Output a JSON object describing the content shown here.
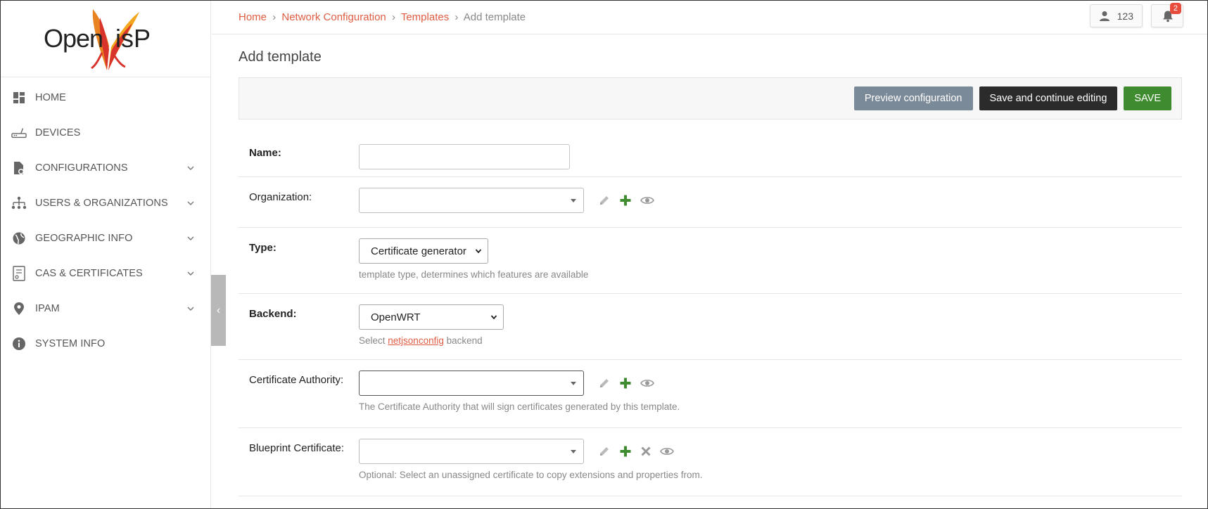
{
  "brand": {
    "logo_text": "OpenWISP"
  },
  "sidebar": {
    "items": [
      {
        "label": "HOME",
        "icon": "dashboard-icon",
        "expandable": false
      },
      {
        "label": "DEVICES",
        "icon": "router-icon",
        "expandable": false
      },
      {
        "label": "CONFIGURATIONS",
        "icon": "config-file-icon",
        "expandable": true
      },
      {
        "label": "USERS & ORGANIZATIONS",
        "icon": "org-chart-icon",
        "expandable": true
      },
      {
        "label": "GEOGRAPHIC INFO",
        "icon": "globe-icon",
        "expandable": true
      },
      {
        "label": "CAS & CERTIFICATES",
        "icon": "certificate-icon",
        "expandable": true
      },
      {
        "label": "IPAM",
        "icon": "location-pin-icon",
        "expandable": true
      },
      {
        "label": "SYSTEM INFO",
        "icon": "info-icon",
        "expandable": false
      }
    ],
    "collapse_glyph": "‹"
  },
  "header": {
    "breadcrumb": {
      "home": "Home",
      "network_configuration": "Network Configuration",
      "templates": "Templates",
      "current": "Add template",
      "separator": "›"
    },
    "user_label": "123",
    "notifications_count": "2"
  },
  "main": {
    "title": "Add template",
    "actions": {
      "preview": "Preview configuration",
      "save_continue": "Save and continue editing",
      "save": "SAVE"
    },
    "form": {
      "name": {
        "label": "Name:",
        "value": ""
      },
      "organization": {
        "label": "Organization:",
        "value": ""
      },
      "type": {
        "label": "Type:",
        "value": "Certificate generator",
        "help": "template type, determines which features are available"
      },
      "backend": {
        "label": "Backend:",
        "value": "OpenWRT",
        "help_prefix": "Select ",
        "help_link": "netjsonconfig",
        "help_suffix": " backend"
      },
      "ca": {
        "label": "Certificate Authority:",
        "value": "",
        "help": "The Certificate Authority that will sign certificates generated by this template."
      },
      "blueprint": {
        "label": "Blueprint Certificate:",
        "value": "",
        "help": "Optional: Select an unassigned certificate to copy extensions and properties from."
      }
    }
  },
  "colors": {
    "accent": "#df5d43",
    "save": "#3f8b2f",
    "preview": "#7b8a99",
    "continue": "#2b2b2b",
    "add": "#3f8b2f",
    "badge": "#e74c3c"
  }
}
